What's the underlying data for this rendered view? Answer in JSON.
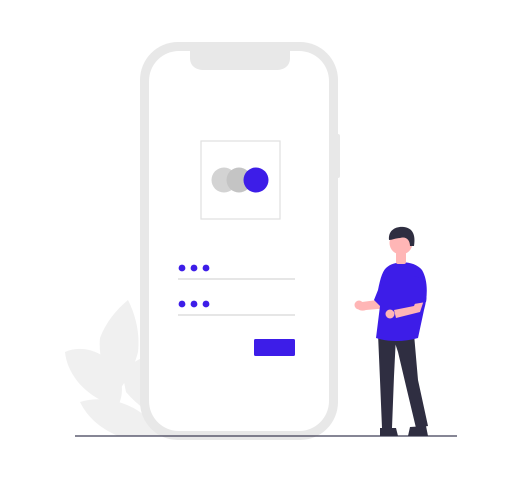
{
  "illustration": {
    "accent_color": "#3d1de8",
    "phone_frame_color": "#e8e8e8",
    "phone_screen_color": "#ffffff",
    "logo_inactive_colors": [
      "#d3d3d3",
      "#c4c4c4"
    ],
    "underline_color": "#d6d6d6",
    "ground_color": "#3f3d56",
    "plant_color": "#f0f0f0",
    "skin_color": "#ffb6b6",
    "hair_color": "#2f2e41",
    "pants_color": "#2f2e41",
    "shoe_color": "#2f2e41"
  },
  "login_form": {
    "username_mask": "•••",
    "password_mask": "•••",
    "submit_label": ""
  }
}
